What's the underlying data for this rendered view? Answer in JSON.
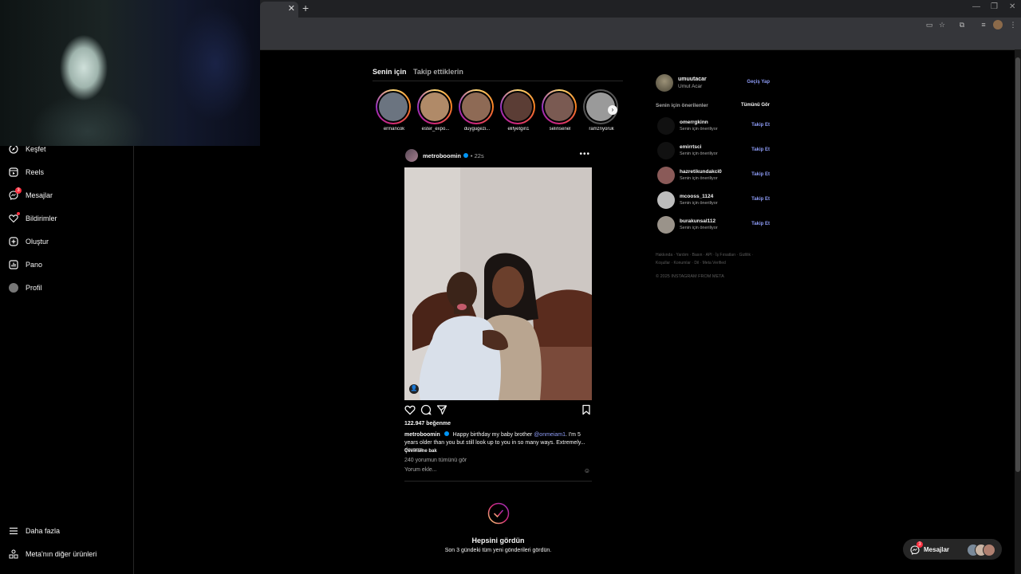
{
  "feed_tabs": {
    "for_you": "Senin için",
    "following": "Takip ettiklerin"
  },
  "nav": {
    "items": [
      {
        "label": "Keşfet",
        "icon": "compass-icon"
      },
      {
        "label": "Reels",
        "icon": "reels-icon"
      },
      {
        "label": "Mesajlar",
        "icon": "messenger-icon",
        "badge": "3"
      },
      {
        "label": "Bildirimler",
        "icon": "heart-icon"
      },
      {
        "label": "Oluştur",
        "icon": "plus-square-icon"
      },
      {
        "label": "Pano",
        "icon": "dashboard-icon"
      },
      {
        "label": "Profil",
        "icon": "avatar"
      }
    ],
    "more": "Daha fazla",
    "meta_products": "Meta'nın diğer ürünleri"
  },
  "stories": [
    {
      "username": "ermancok",
      "seen": false,
      "color": "#6b7480"
    },
    {
      "username": "ester_expo...",
      "seen": false,
      "color": "#b08a68"
    },
    {
      "username": "duygugezi...",
      "seen": false,
      "color": "#8e6a55"
    },
    {
      "username": "elifyetgin1",
      "seen": false,
      "color": "#5b3d35"
    },
    {
      "username": "selinsenel",
      "seen": false,
      "color": "#7a5a52"
    },
    {
      "username": "ramznyoruk",
      "seen": true,
      "color": "#9a9a9a"
    }
  ],
  "post": {
    "username": "metroboomin",
    "time": "22s",
    "more_icon": "•••",
    "likes": "122.947 beğenme",
    "caption_user": "metroboomin",
    "caption_text_1": "Happy birthday my baby brother",
    "caption_mention": "@onmeiam1",
    "caption_text_2": ". I'm 5 years older than you but still look up to you in so many ways. Extremely...",
    "caption_more": "devamı",
    "see_translation": "Çevirisine bak",
    "view_comments": "240 yorumun tümünü gör",
    "add_comment_placeholder": "Yorum ekle...",
    "tag_icon": "user-tag-icon"
  },
  "caught_up": {
    "title": "Hepsini gördün",
    "subtitle": "Son 3 gündeki tüm yeni gönderileri gördün."
  },
  "sidebar": {
    "me": {
      "username": "umuutacar",
      "name": "Umut Acar",
      "switch": "Geçiş Yap"
    },
    "suggestions_title": "Senin için önerilenler",
    "see_all": "Tümünü Gör",
    "suggestions": [
      {
        "username": "omerrgkinn",
        "sub": "Senin için öneriliyor",
        "action": "Takip Et",
        "color": "#111111"
      },
      {
        "username": "emirrtsci",
        "sub": "Senin için öneriliyor",
        "action": "Takip Et",
        "color": "#111111"
      },
      {
        "username": "hazretikundakci0",
        "sub": "Senin için öneriliyor",
        "action": "Takip Et",
        "color": "#8a5a58"
      },
      {
        "username": "mcooss_1124",
        "sub": "Senin için öneriliyor",
        "action": "Takip Et",
        "color": "#bdbdbd"
      },
      {
        "username": "burakunsal112",
        "sub": "Senin için öneriliyor",
        "action": "Takip Et",
        "color": "#9a938a"
      }
    ],
    "footer_line_1": "Hakkında · Yardım · Basın · API · İş Fırsatları · Gizlilik ·",
    "footer_line_2": "Koşullar · Konumlar · Dil · Meta Verified",
    "copyright": "© 2025 INSTAGRAM FROM META"
  },
  "messages_pill": {
    "label": "Mesajlar",
    "badge": "3"
  },
  "colors": {
    "accent": "#8e9cf7",
    "badge": "#ff3040",
    "verified": "#0095f6"
  }
}
